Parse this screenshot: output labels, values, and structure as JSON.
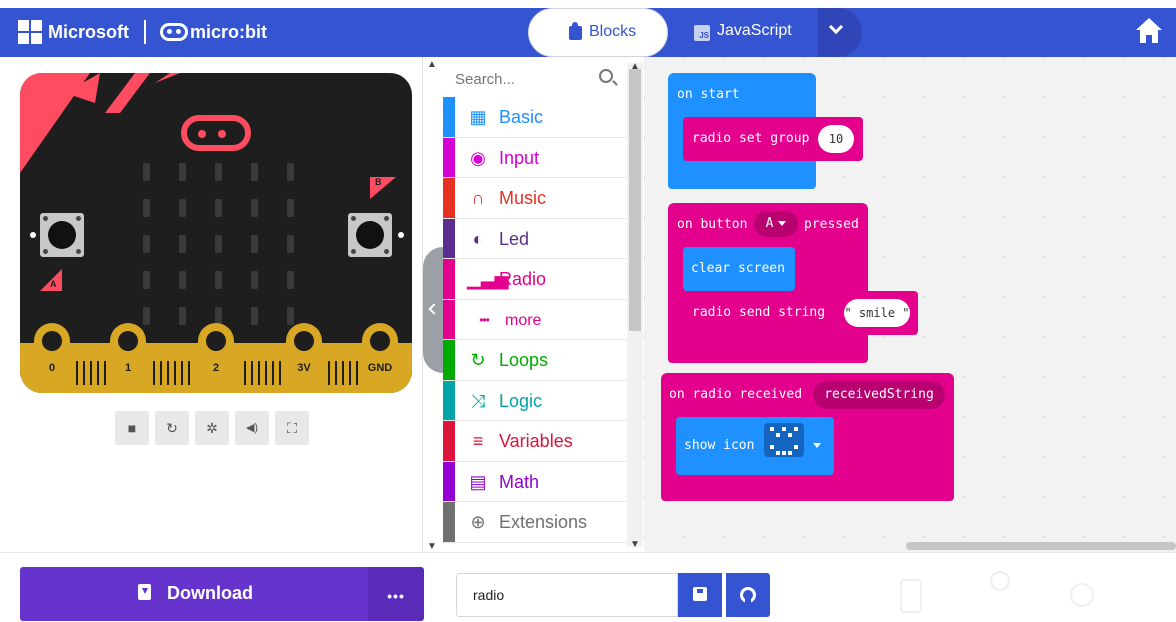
{
  "header": {
    "microsoft_label": "Microsoft",
    "microbit_label": "micro:bit",
    "blocks_tab": "Blocks",
    "javascript_tab": "JavaScript",
    "javascript_badge": "JS",
    "home_icon": "home-icon",
    "colors": {
      "bar": "#3454D1"
    }
  },
  "simulator": {
    "button_a_label": "A",
    "button_b_label": "B",
    "pins": [
      "0",
      "1",
      "2",
      "3V",
      "GND"
    ],
    "controls": [
      {
        "icon": "stop-icon",
        "glyph": "■"
      },
      {
        "icon": "restart-icon",
        "glyph": "↻"
      },
      {
        "icon": "debug-icon",
        "glyph": "✲"
      },
      {
        "icon": "sound-icon",
        "glyph": "◀)"
      },
      {
        "icon": "fullscreen-icon",
        "glyph": "⛶"
      }
    ]
  },
  "toolbox": {
    "search_placeholder": "Search...",
    "categories": [
      {
        "label": "Basic",
        "color": "#1e90ff",
        "icon": "grid-icon",
        "glyph": "▦"
      },
      {
        "label": "Input",
        "color": "#d400d4",
        "icon": "input-icon",
        "glyph": "◉"
      },
      {
        "label": "Music",
        "color": "#e63022",
        "icon": "headphones-icon",
        "glyph": "∩"
      },
      {
        "label": "Led",
        "color": "#5c2d91",
        "icon": "toggle-icon",
        "glyph": "◐"
      },
      {
        "label": "Radio",
        "color": "#e3008c",
        "icon": "signal-icon",
        "glyph": "▁▃▅"
      },
      {
        "label": "more",
        "color": "#e3008c",
        "icon": "more-icon",
        "glyph": "•••",
        "sub": true
      },
      {
        "label": "Loops",
        "color": "#00aa00",
        "icon": "loop-icon",
        "glyph": "↻"
      },
      {
        "label": "Logic",
        "color": "#00a4a6",
        "icon": "shuffle-icon",
        "glyph": "⤨"
      },
      {
        "label": "Variables",
        "color": "#dc143c",
        "icon": "list-icon",
        "glyph": "≡"
      },
      {
        "label": "Math",
        "color": "#9400d3",
        "icon": "calculator-icon",
        "glyph": "▤"
      },
      {
        "label": "Extensions",
        "color": "#707070",
        "icon": "plus-icon",
        "glyph": "⊕"
      }
    ]
  },
  "workspace": {
    "on_start": {
      "label": "on start",
      "inner_label": "radio set group",
      "group_value": "10"
    },
    "on_button": {
      "prefix": "on button",
      "button": "A",
      "suffix": "pressed",
      "clear_label": "clear screen",
      "send_label": "radio send string",
      "send_value": "\" smile \""
    },
    "on_received": {
      "label": "on radio received",
      "var_name": "receivedString",
      "show_icon_label": "show icon"
    }
  },
  "footer": {
    "download_label": "Download",
    "more_label": "•••",
    "project_name": "radio"
  }
}
